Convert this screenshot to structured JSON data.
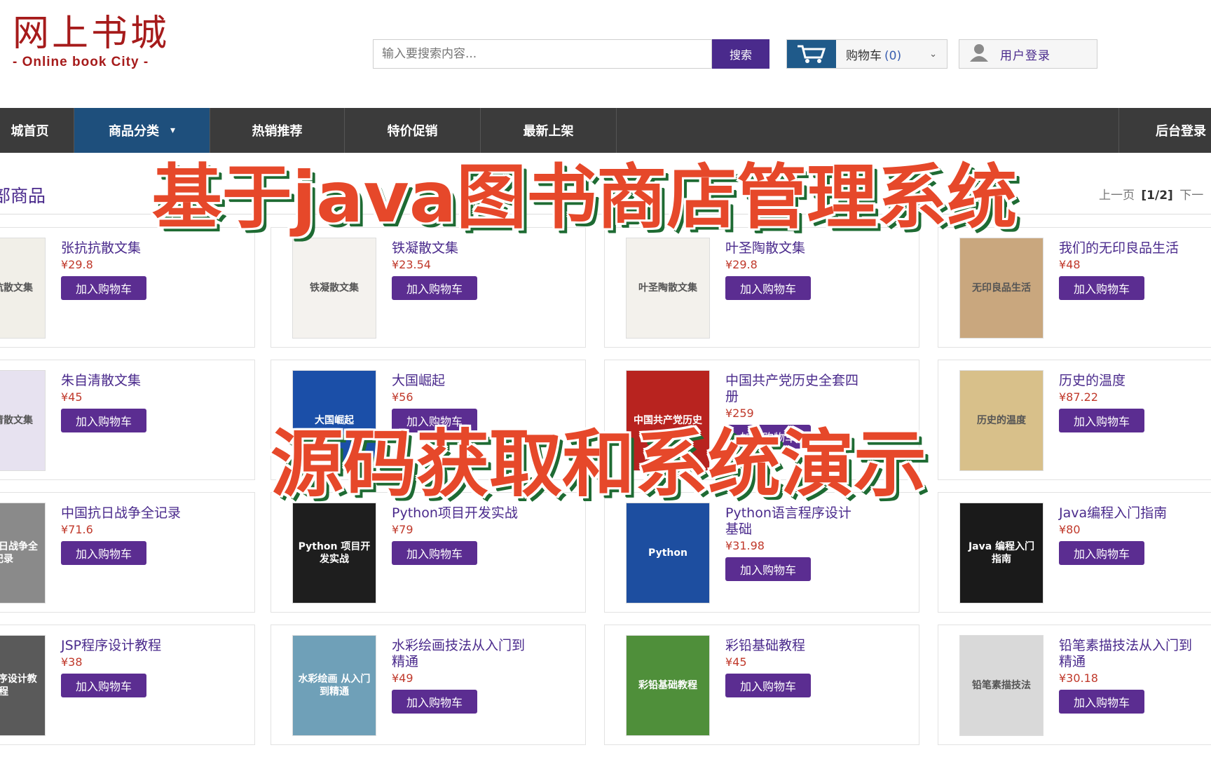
{
  "header": {
    "logo_cn": "网上书城",
    "logo_en": "- Online book City -",
    "search_placeholder": "输入要搜索内容...",
    "search_button": "搜索",
    "cart_label": "购物车",
    "cart_count": "(0)",
    "login_label": "用户登录"
  },
  "nav": {
    "items": [
      "城首页",
      "商品分类",
      "热销推荐",
      "特价促销",
      "最新上架",
      "后台登录"
    ],
    "dropdown_caret": "▾"
  },
  "listing": {
    "title": "部商品",
    "pager_prev": "上一页",
    "pager_current": "[1/2]",
    "pager_next": "下一"
  },
  "colors": {
    "accent": "#5b2d91",
    "nav_bg": "#3b3b3b",
    "nav_active": "#1e4f7c",
    "price": "#c0392b",
    "overlay_text": "#e6482a"
  },
  "add_to_cart_label": "加入购物车",
  "products": [
    {
      "title": "张抗抗散文集",
      "price": "¥29.8",
      "cover_text": "张抗抗散文集",
      "cover_color": "#f1efe8"
    },
    {
      "title": "铁凝散文集",
      "price": "¥23.54",
      "cover_text": "铁凝散文集",
      "cover_color": "#f4f2ee"
    },
    {
      "title": "叶圣陶散文集",
      "price": "¥29.8",
      "cover_text": "叶圣陶散文集",
      "cover_color": "#f3f1ec"
    },
    {
      "title": "我们的无印良品生活",
      "price": "¥48",
      "cover_text": "无印良品生活",
      "cover_color": "#c9a77e"
    },
    {
      "title": "朱自清散文集",
      "price": "¥45",
      "cover_text": "朱自清散文集",
      "cover_color": "#e7e2f0"
    },
    {
      "title": "大国崛起",
      "price": "¥56",
      "cover_text": "大国崛起",
      "cover_color": "#1b4fa8"
    },
    {
      "title": "中国共产党历史全套四册",
      "price": "¥259",
      "cover_text": "中国共产党历史",
      "cover_color": "#b8231f"
    },
    {
      "title": "历史的温度",
      "price": "¥87.22",
      "cover_text": "历史的温度",
      "cover_color": "#d8c08a"
    },
    {
      "title": "中国抗日战争全记录",
      "price": "¥71.6",
      "cover_text": "中国抗日战争全记录",
      "cover_color": "#8a8a8a"
    },
    {
      "title": "Python项目开发实战",
      "price": "¥79",
      "cover_text": "Python 项目开发实战",
      "cover_color": "#1e1e1e"
    },
    {
      "title": "Python语言程序设计基础",
      "price": "¥31.98",
      "cover_text": "Python",
      "cover_color": "#1d4ea0"
    },
    {
      "title": "Java编程入门指南",
      "price": "¥80",
      "cover_text": "Java 编程入门指南",
      "cover_color": "#1a1a1a"
    },
    {
      "title": "JSP程序设计教程",
      "price": "¥38",
      "cover_text": "JSP程序设计教程",
      "cover_color": "#5a5a5a"
    },
    {
      "title": "水彩绘画技法从入门到精通",
      "price": "¥49",
      "cover_text": "水彩绘画 从入门到精通",
      "cover_color": "#6fa0b8"
    },
    {
      "title": "彩铅基础教程",
      "price": "¥45",
      "cover_text": "彩铅基础教程",
      "cover_color": "#4f8f3a"
    },
    {
      "title": "铅笔素描技法从入门到精通",
      "price": "¥30.18",
      "cover_text": "铅笔素描技法",
      "cover_color": "#d9d9d9"
    }
  ],
  "overlay": {
    "line1": "基于java图书商店管理系统",
    "line2": "源码获取和系统演示"
  }
}
